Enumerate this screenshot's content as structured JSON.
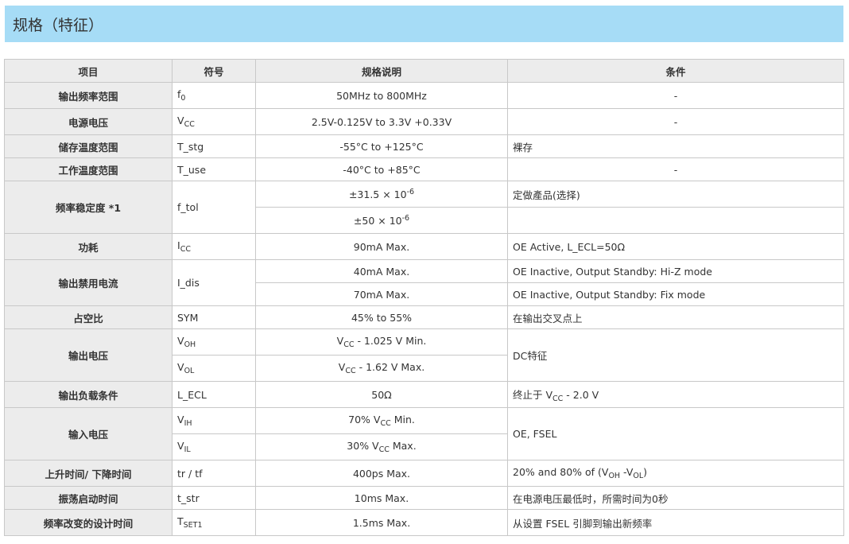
{
  "header": {
    "title": "规格（特征）"
  },
  "columns": {
    "item": "项目",
    "symbol": "符号",
    "spec": "规格说明",
    "condition": "条件"
  },
  "rows": {
    "freq_range": {
      "item": "输出频率范围",
      "sym": "f",
      "sym_sub": "0",
      "spec": "50MHz to 800MHz",
      "cond": "-"
    },
    "supply_voltage": {
      "item": "电源电压",
      "sym": "V",
      "sym_sub": "CC",
      "spec": "2.5V-0.125V to 3.3V +0.33V",
      "cond": "-"
    },
    "storage_temp": {
      "item": "储存温度范围",
      "sym": "T_stg",
      "spec": "-55°C to +125°C",
      "cond": "裸存"
    },
    "operating_temp": {
      "item": "工作温度范围",
      "sym": "T_use",
      "spec": "-40°C to +85°C",
      "cond": "-"
    },
    "freq_tolerance": {
      "item": "频率稳定度 *1",
      "sym": "f_tol",
      "spec1_pre": "±31.5 × 10",
      "spec1_exp": "-6",
      "cond1": "定做產品(选择)",
      "spec2_pre": "±50 × 10",
      "spec2_exp": "-6",
      "cond2": ""
    },
    "power": {
      "item": "功耗",
      "sym": "I",
      "sym_sub": "CC",
      "spec": "90mA Max.",
      "cond": "OE Active, L_ECL=50Ω"
    },
    "disable_current": {
      "item": "输出禁用电流",
      "sym": "I_dis",
      "spec1": "40mA Max.",
      "cond1": "OE Inactive, Output Standby: Hi-Z mode",
      "spec2": "70mA Max.",
      "cond2": "OE Inactive, Output Standby: Fix mode"
    },
    "duty": {
      "item": "占空比",
      "sym": "SYM",
      "spec": "45% to 55%",
      "cond": "在输出交叉点上"
    },
    "output_voltage": {
      "item": "输出电压",
      "sym1": "V",
      "sym1_sub": "OH",
      "spec1_a": "V",
      "spec1_sub": "CC",
      "spec1_b": " - 1.025 V Min.",
      "sym2": "V",
      "sym2_sub": "OL",
      "spec2_a": "V",
      "spec2_sub": "CC",
      "spec2_b": " - 1.62 V Max.",
      "cond": "DC特征"
    },
    "output_load": {
      "item": "输出负载条件",
      "sym": "L_ECL",
      "spec": "50Ω",
      "cond_a": "终止于 V",
      "cond_sub": "CC",
      "cond_b": " - 2.0 V"
    },
    "input_voltage": {
      "item": "输入电压",
      "sym1": "V",
      "sym1_sub": "IH",
      "spec1_a": "70% V",
      "spec1_sub": "CC",
      "spec1_b": " Min.",
      "sym2": "V",
      "sym2_sub": "IL",
      "spec2_a": "30% V",
      "spec2_sub": "CC",
      "spec2_b": " Max.",
      "cond": "OE, FSEL"
    },
    "rise_fall": {
      "item": "上升时间/ 下降时间",
      "sym": "tr / tf",
      "spec": "400ps Max.",
      "cond_a": "20% and 80% of (V",
      "cond_sub1": "OH",
      "cond_mid": " -V",
      "cond_sub2": "OL",
      "cond_b": ")"
    },
    "startup": {
      "item": "振荡启动时间",
      "sym": "t_str",
      "spec": "10ms Max.",
      "cond": "在电源电压最低时，所需时间为0秒"
    },
    "settle": {
      "item": "频率改变的设计时间",
      "sym": "T",
      "sym_sub": "SET1",
      "spec": "1.5ms Max.",
      "cond": "从设置 FSEL 引脚到输出新频率"
    }
  }
}
